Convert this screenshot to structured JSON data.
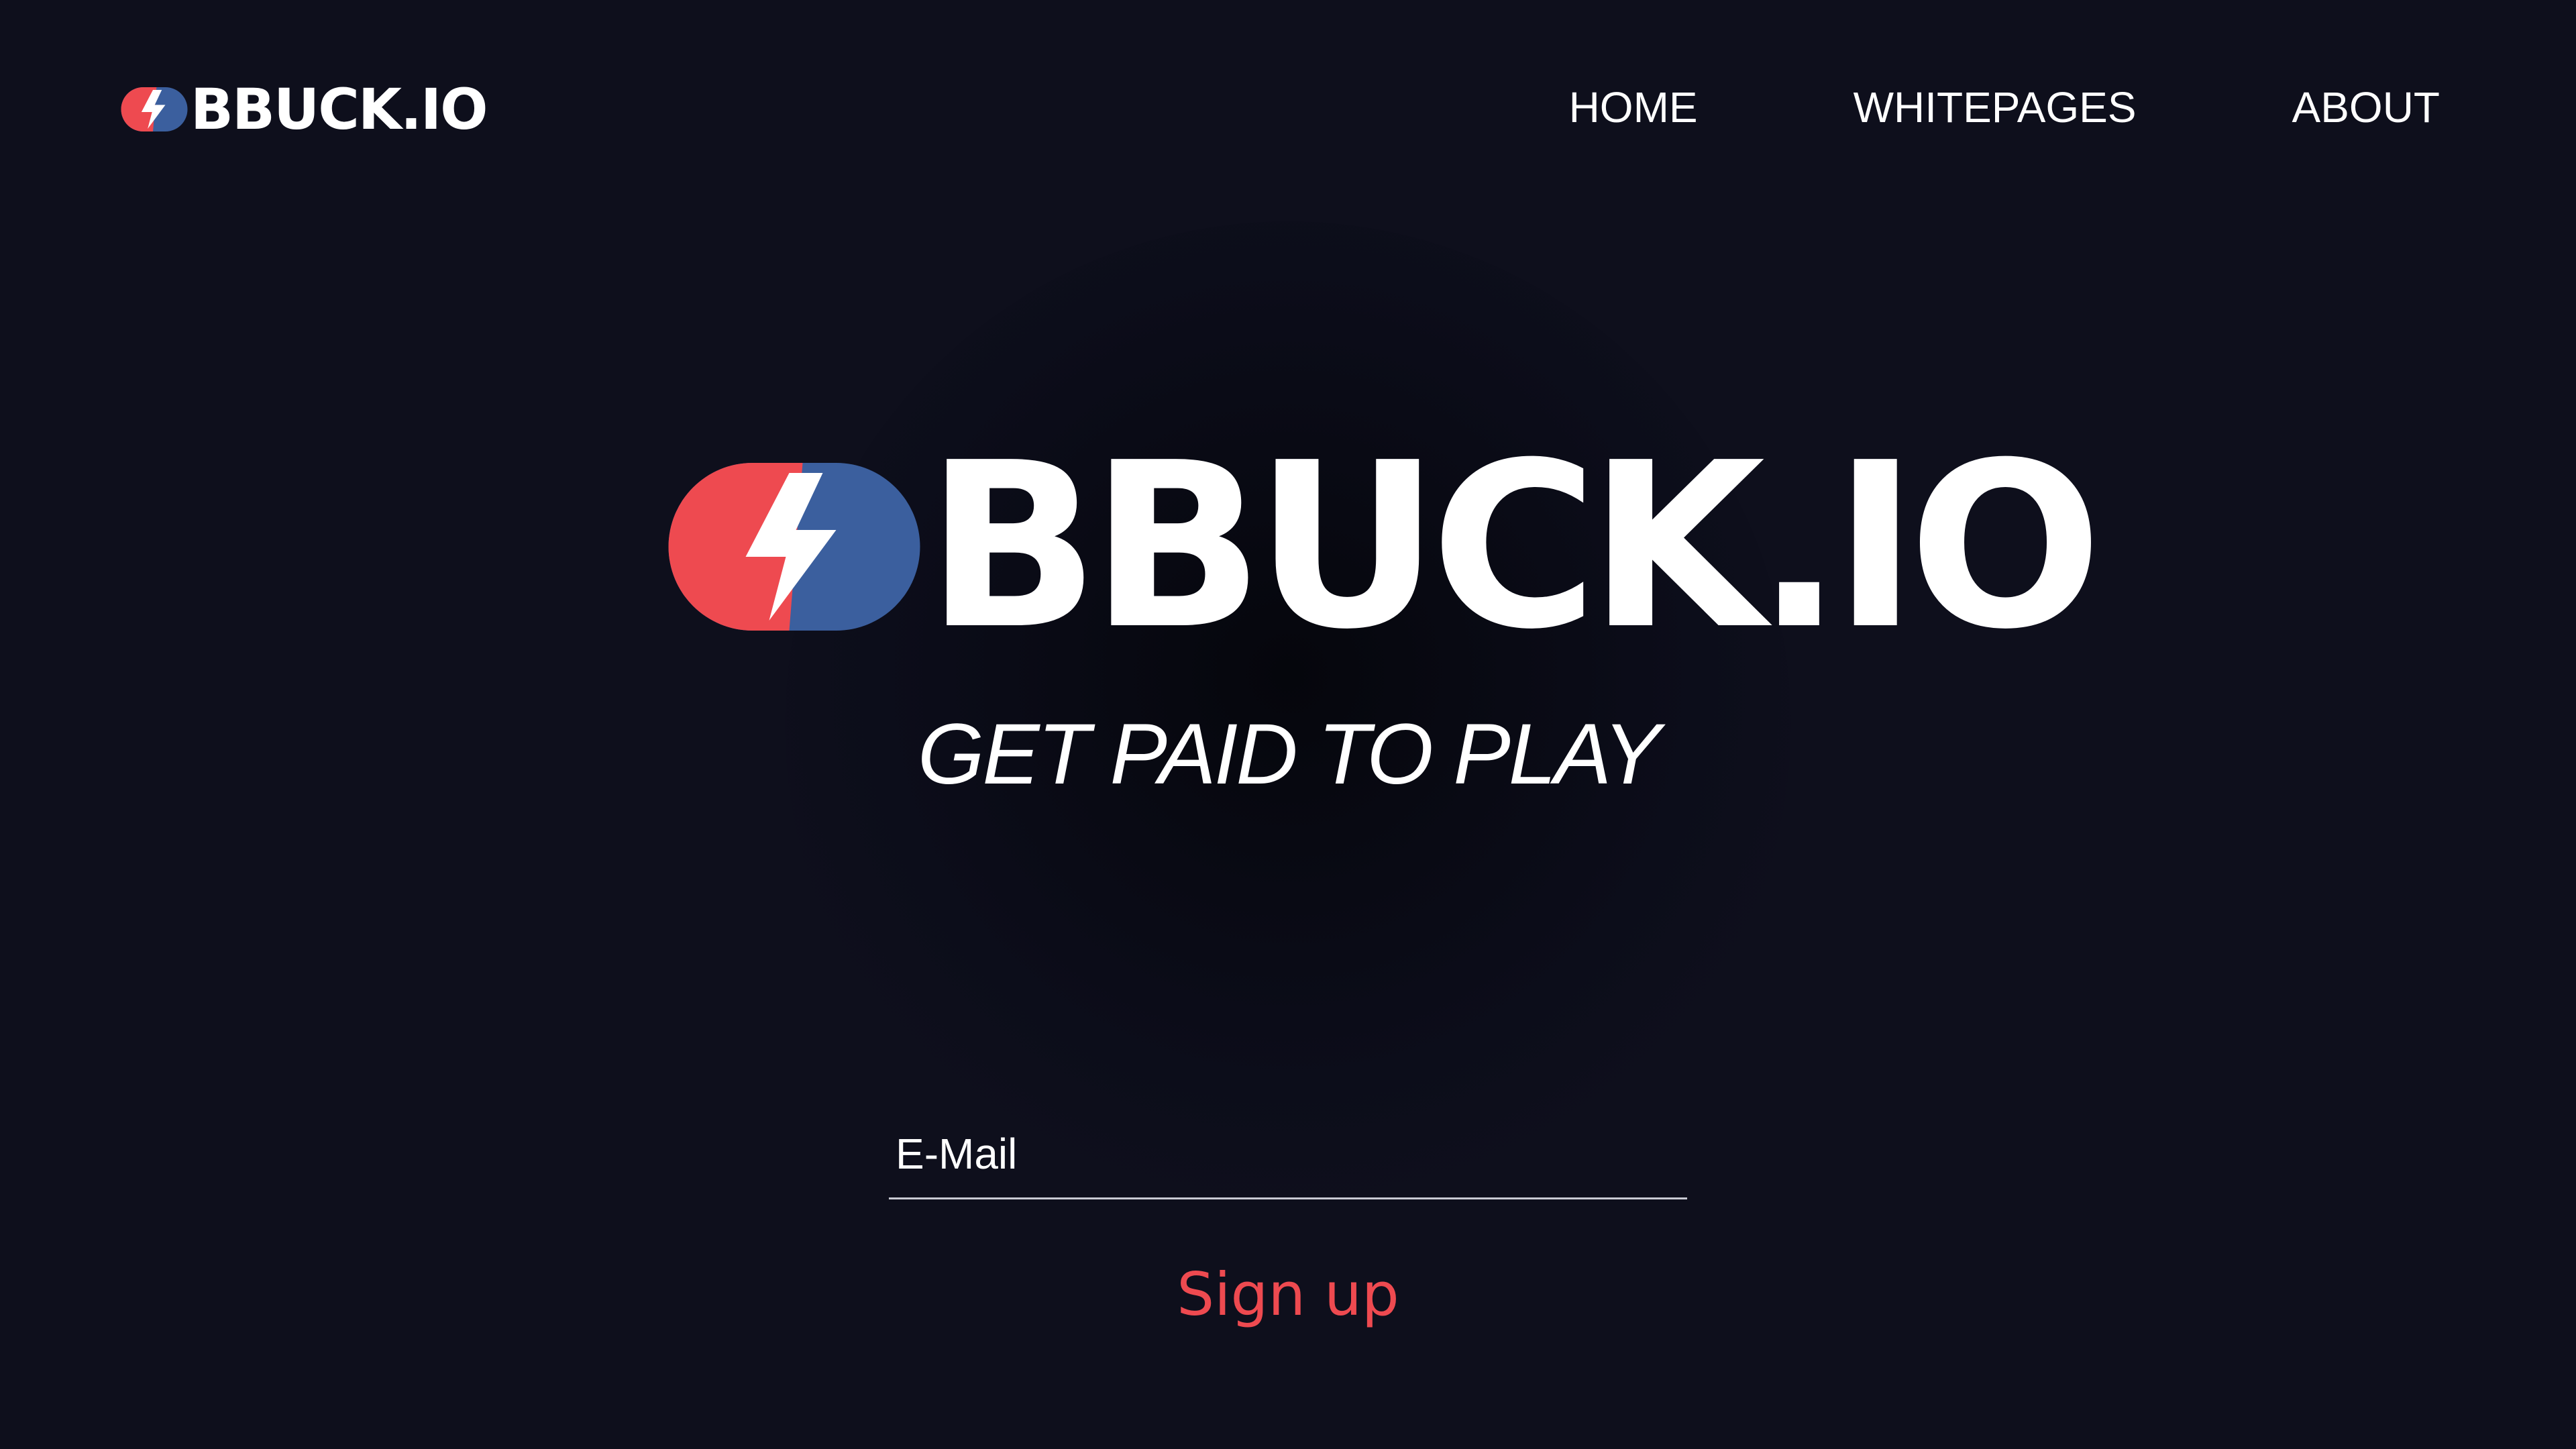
{
  "brand": {
    "name": "BBUCK.IO",
    "colors": {
      "red": "#ee4a50",
      "blue": "#3b5f9e",
      "background": "#0e0f1c"
    },
    "logo_icon": "lightning-pill-icon"
  },
  "nav": {
    "items": [
      {
        "label": "HOME"
      },
      {
        "label": "WHITEPAGES"
      },
      {
        "label": "ABOUT"
      }
    ]
  },
  "hero": {
    "title": "BBUCK.IO",
    "tagline": "GET PAID TO PLAY"
  },
  "signup_form": {
    "email_placeholder": "E-Mail",
    "button_label": "Sign up"
  }
}
